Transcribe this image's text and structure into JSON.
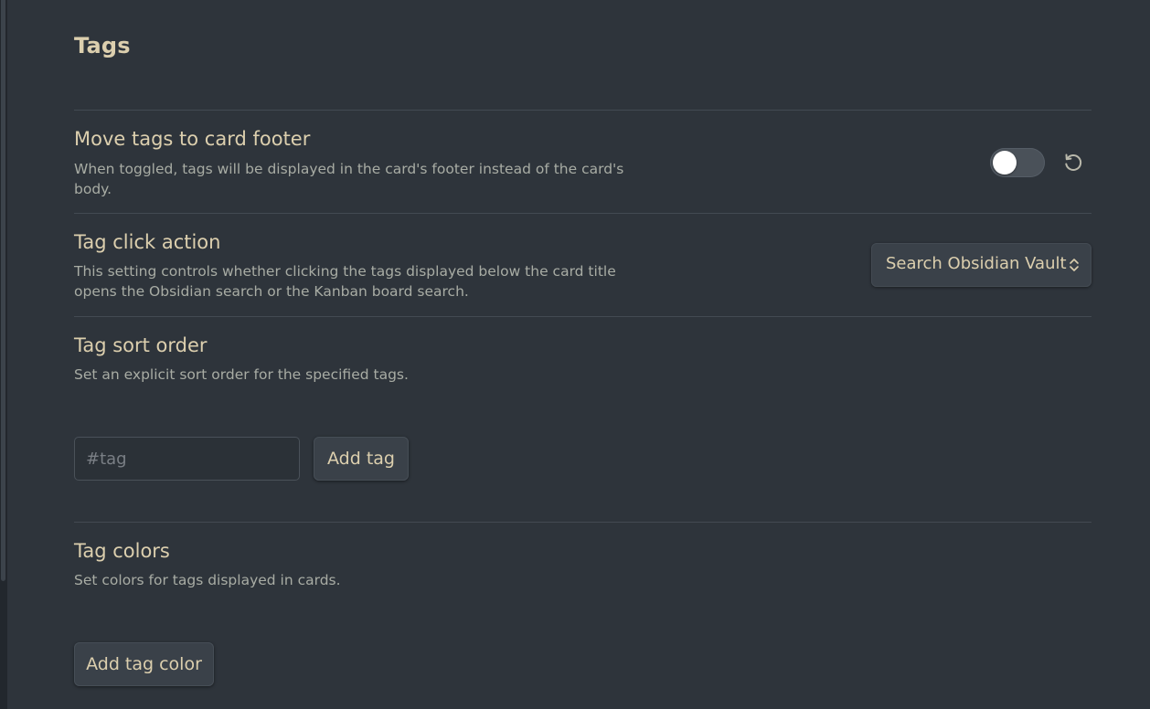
{
  "section": {
    "title": "Tags"
  },
  "settings": {
    "move_tags": {
      "name": "Move tags to card footer",
      "description": "When toggled, tags will be displayed in the card's footer instead of the card's body.",
      "toggle_on": false
    },
    "tag_click": {
      "name": "Tag click action",
      "description": "This setting controls whether clicking the tags displayed below the card title opens the Obsidian search or the Kanban board search.",
      "selected": "Search Obsidian Vault"
    },
    "tag_sort": {
      "name": "Tag sort order",
      "description": "Set an explicit sort order for the specified tags.",
      "input_placeholder": "#tag",
      "input_value": "",
      "add_button": "Add tag"
    },
    "tag_colors": {
      "name": "Tag colors",
      "description": "Set colors for tags displayed in cards.",
      "add_button": "Add tag color"
    }
  },
  "icons": {
    "reset": "reset-icon",
    "select_chevron": "chevron-updown-icon"
  },
  "colors": {
    "background": "#2e343b",
    "heading": "#dccfae",
    "description": "#a8aca4"
  }
}
